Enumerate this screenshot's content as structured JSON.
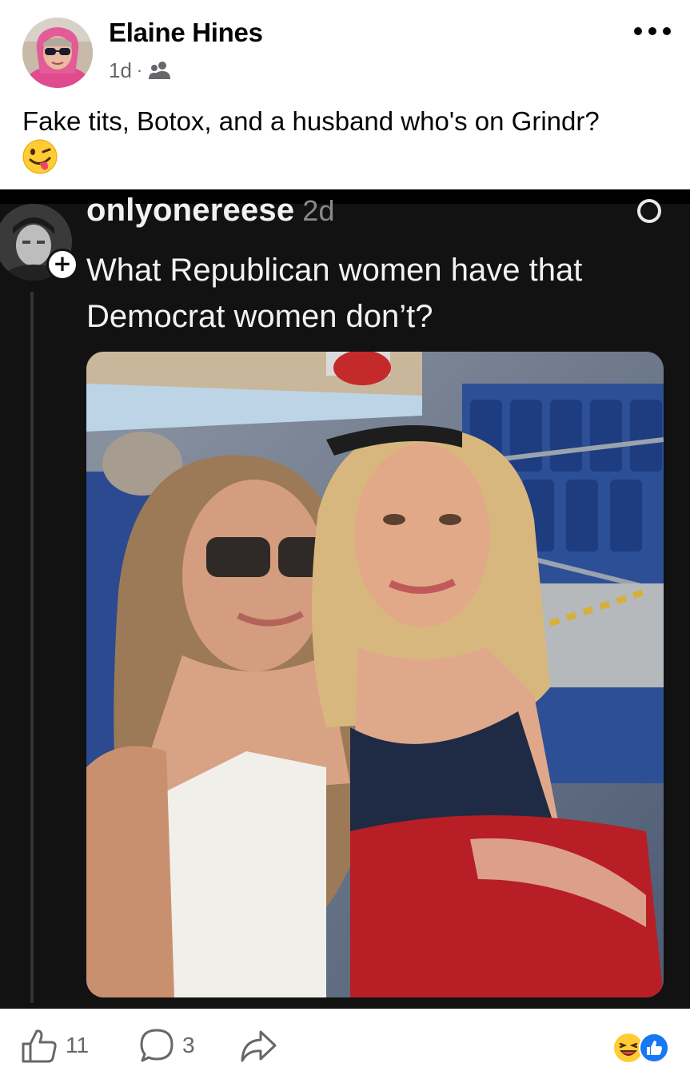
{
  "post": {
    "author": "Elaine Hines",
    "time": "1d",
    "audience_icon": "friends-icon",
    "caption": "Fake tits, Botox, and a husband who's on Grindr?",
    "caption_emoji": "winking-face-with-tongue"
  },
  "shared_screenshot": {
    "username": "onlyonereese",
    "time": "2d",
    "text": "What Republican women have that Democrat women don’t?",
    "photo_description": ""
  },
  "actions": {
    "likes_count": "11",
    "comments_count": "3",
    "reactions": [
      "laughing-face-icon",
      "thumbs-up-icon"
    ]
  },
  "colors": {
    "primary_text": "#050505",
    "secondary_text": "#65676b",
    "like_blue": "#1877f2",
    "screenshot_bg": "#121212"
  }
}
